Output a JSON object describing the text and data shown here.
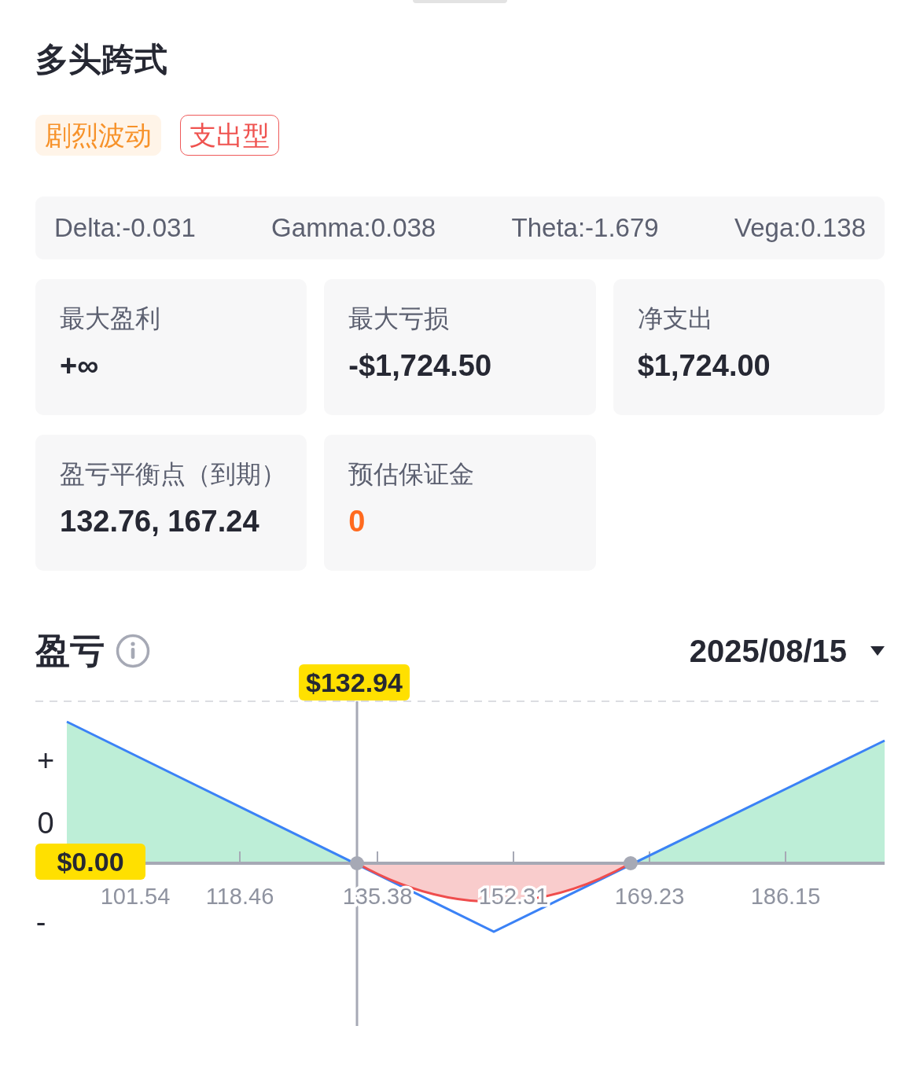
{
  "title": "多头跨式",
  "tags": [
    {
      "label": "剧烈波动",
      "kind": "soft"
    },
    {
      "label": "支出型",
      "kind": "outline"
    }
  ],
  "greeks": [
    "Delta:-0.031",
    "Gamma:0.038",
    "Theta:-1.679",
    "Vega:0.138"
  ],
  "metrics": [
    {
      "label": "最大盈利",
      "value": "+∞",
      "kind": "plain"
    },
    {
      "label": "最大亏损",
      "value": "-$1,724.50",
      "kind": "plain"
    },
    {
      "label": "净支出",
      "value": "$1,724.00",
      "kind": "plain"
    },
    {
      "label": "盈亏平衡点（到期）",
      "value": "132.76, 167.24",
      "kind": "plain"
    },
    {
      "label": "预估保证金",
      "value": "0",
      "kind": "accent"
    }
  ],
  "pnl": {
    "title": "盈亏",
    "date": "2025/08/15",
    "y_labels": [
      "+",
      "0",
      "-"
    ],
    "x_labels": [
      "101.54",
      "118.46",
      "135.38",
      "152.31",
      "169.23",
      "186.15"
    ],
    "crosshair_price": "$132.94",
    "crosshair_pnl": "$0.00"
  }
}
